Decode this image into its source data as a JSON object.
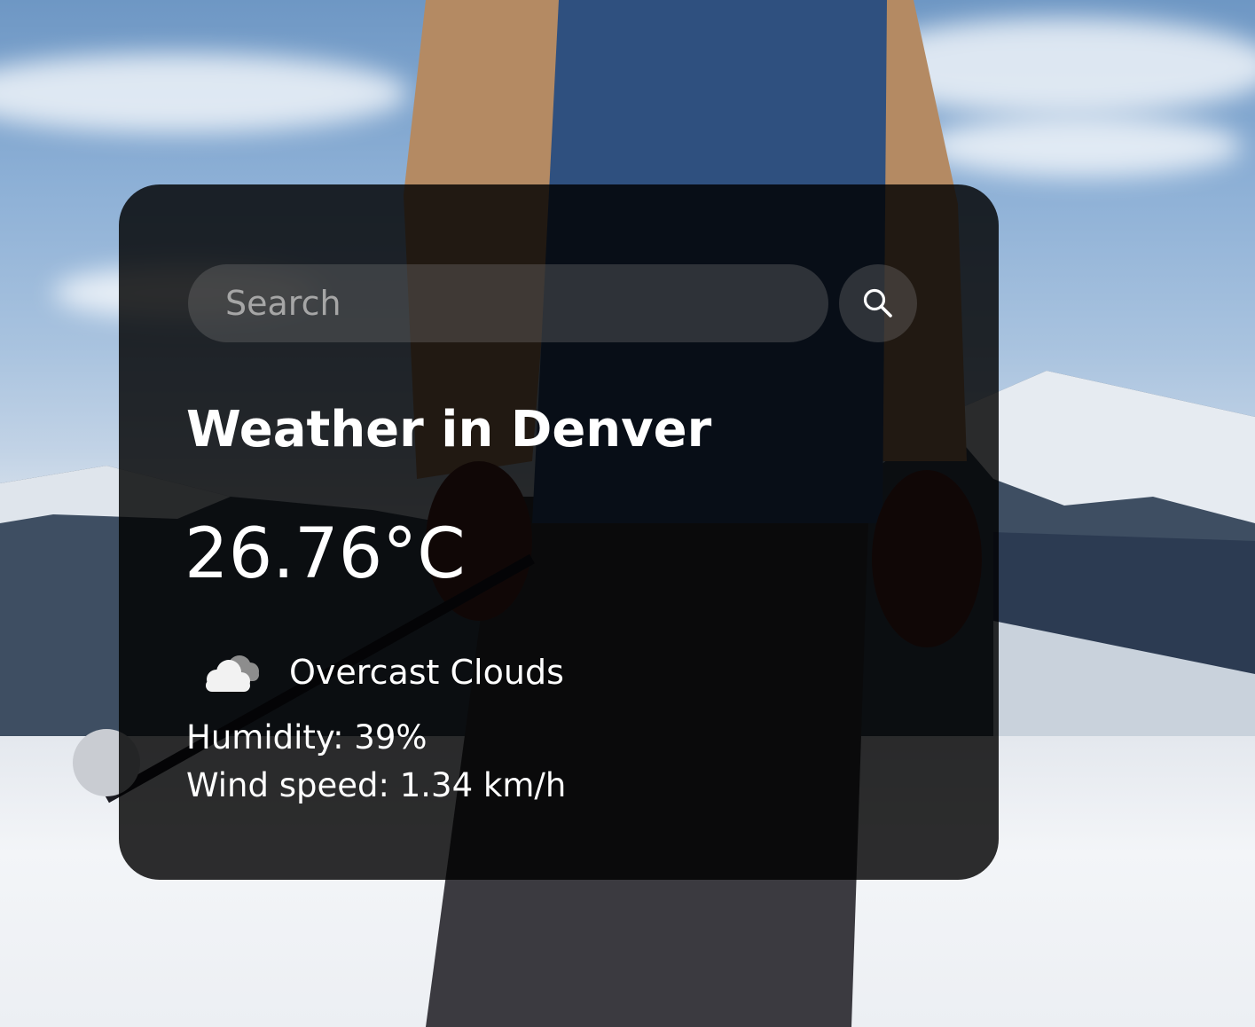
{
  "search": {
    "placeholder": "Search",
    "value": "",
    "button_icon": "search-icon"
  },
  "weather": {
    "title": "Weather in Denver",
    "temperature": "26.76°C",
    "condition_icon": "cloud-icon",
    "condition": "Overcast Clouds",
    "humidity": "Humidity: 39%",
    "wind": "Wind speed: 1.34 km/h"
  },
  "colors": {
    "card_background": "#000000",
    "text": "#ffffff",
    "input_background": "#7c7c7c"
  }
}
